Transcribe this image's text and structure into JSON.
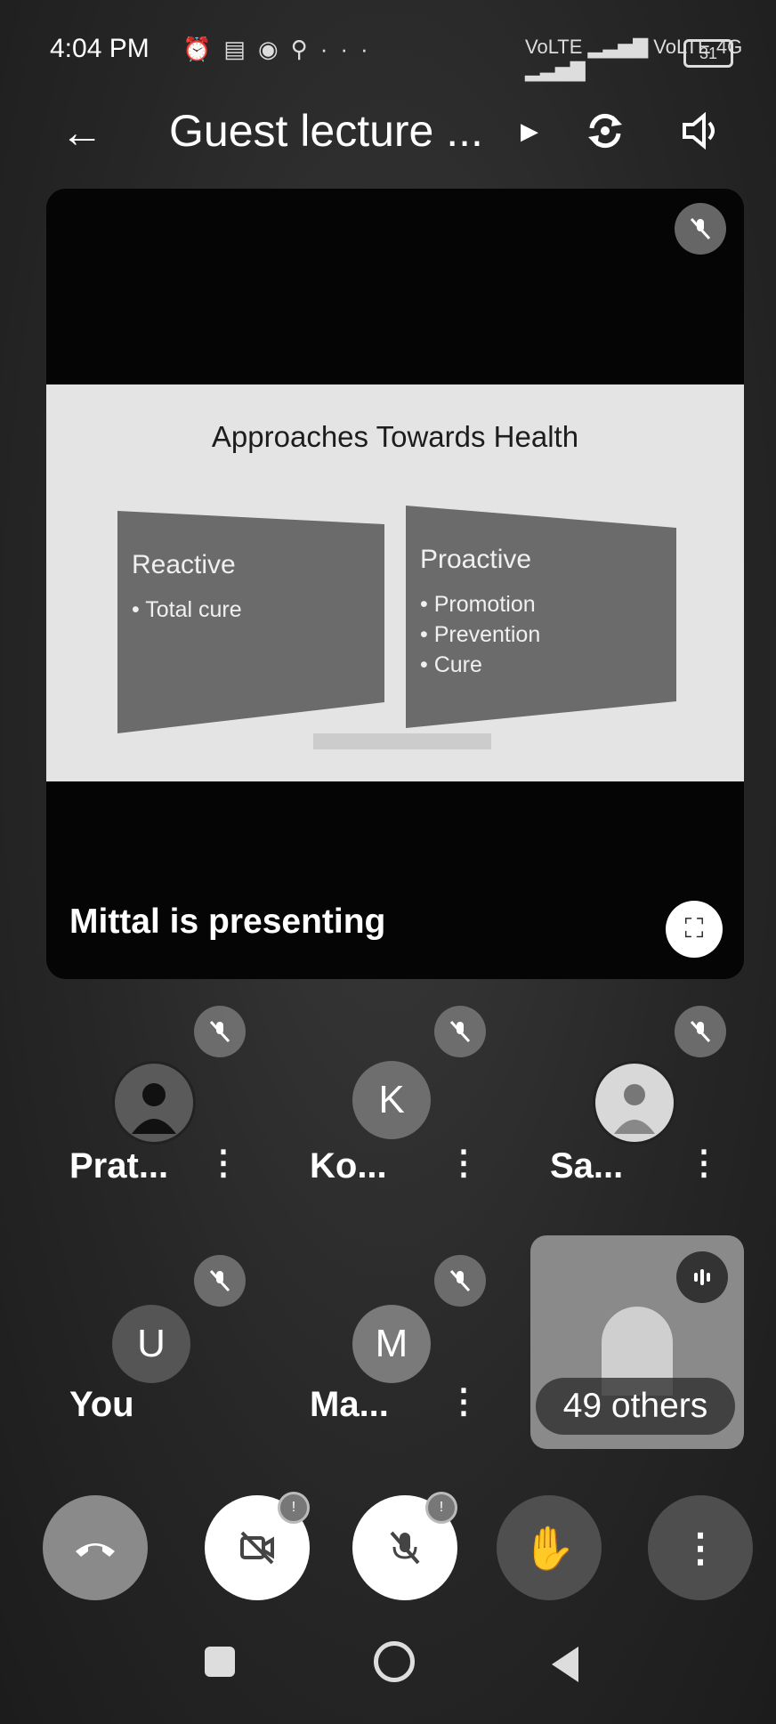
{
  "status_bar": {
    "time": "4:04 PM",
    "icons": [
      "alarm-icon",
      "message-icon",
      "chrome-icon",
      "location-icon",
      "more-icon"
    ],
    "more": "···",
    "network": "4G",
    "battery": "31"
  },
  "header": {
    "title": "Guest lecture ...",
    "back_icon": "arrow-left-icon",
    "switch_camera_icon": "camera-switch-icon",
    "audio_icon": "speaker-icon"
  },
  "presentation": {
    "slide_title": "Approaches Towards Health",
    "left_panel": {
      "heading": "Reactive",
      "items": [
        "• Total cure"
      ]
    },
    "right_panel": {
      "heading": "Proactive",
      "items": [
        "• Promotion",
        "• Prevention",
        "• Cure"
      ]
    },
    "presenting_label": "Mittal is presenting"
  },
  "participants": [
    {
      "name": "Prat...",
      "initial": "",
      "muted": true
    },
    {
      "name": "Ko...",
      "initial": "K",
      "muted": true
    },
    {
      "name": "Sa...",
      "initial": "",
      "muted": true
    },
    {
      "name": "You",
      "initial": "U",
      "muted": true
    },
    {
      "name": "Ma...",
      "initial": "M",
      "muted": true
    }
  ],
  "others": {
    "label": "49 others"
  },
  "controls": {
    "camera_badge": "!",
    "mic_badge": "!"
  },
  "colors": {
    "background": "#262626",
    "card": "#050505",
    "end_call": "#8a8a8a",
    "white_button": "#ffffff"
  }
}
